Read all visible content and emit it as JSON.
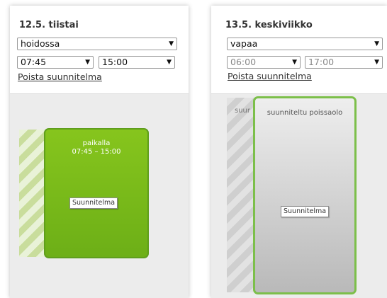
{
  "day_a": {
    "date": "12.5. tiistai",
    "type_select": "hoidossa",
    "start_time": "07:45",
    "end_time": "15:00",
    "remove_link": "Poista suunnitelma",
    "block_title": "paikalla",
    "block_time": "07:45 – 15:00",
    "block_button": "Suunnitelma"
  },
  "day_b": {
    "date": "13.5. keskiviikko",
    "type_select": "vapaa",
    "start_time": "06:00",
    "end_time": "17:00",
    "remove_link": "Poista suunnitelma",
    "bg_label": "suur",
    "block_title": "suunniteltu poissaolo",
    "block_button": "Suunnitelma"
  },
  "arrow_glyph": "▼",
  "colors": {
    "present_green": "#7aba1b",
    "outline_green": "#7cbf4a",
    "absence_grey": "#c4c4c4"
  }
}
